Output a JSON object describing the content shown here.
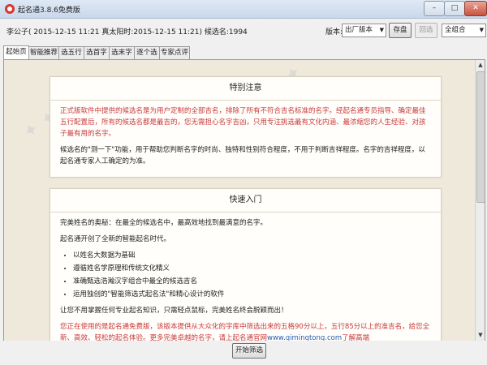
{
  "window": {
    "title": "起名通3.8.6免费版",
    "min_glyph": "–",
    "max_glyph": "□",
    "close_glyph": "✕"
  },
  "infobar": {
    "text": "李公子( 2015-12-15 11:21 真太阳时:2015-12-15 11:21) 候选名:1994",
    "version_label": "版本:",
    "version_value": "出厂版本",
    "save_label": "存盘",
    "pick_label": "回选",
    "combo_value": "全组合"
  },
  "tabs": [
    "起始页",
    "智能推荐",
    "选五行",
    "选首字",
    "选末字",
    "逐个选",
    "专家点评"
  ],
  "cards": {
    "notice": {
      "title": "特别注意",
      "p1": "正式版软件中提供的候选名是为用户定制的全部吉名，排除了所有不符合吉名标准的名字。经起名通专员指导、确定最佳五行配置后，所有的候选名都是最吉的，您无需担心名字吉凶，只用专注挑选最有文化内涵、最浓缩您的人生经验、对孩子最有用的名字。",
      "p2": "候选名的\"测一下\"功能，用于帮助您判断名字的时尚、独特和性别符合程度，不用于判断吉祥程度。名字的吉祥程度，以起名通专家人工确定的为准。"
    },
    "quickstart": {
      "title": "快速入门",
      "p1": "完美姓名的奥秘：在最全的候选名中，最高效地找到最满意的名字。",
      "p2": "起名通开创了全新的智能起名时代。",
      "features": [
        "以姓名大数据为基础",
        "遵循姓名学原理和传统文化精义",
        "准确甄选浩瀚汉字组合中最全的候选吉名",
        "运用独创的\"智能筛选式起名法\"和精心设计的软件"
      ],
      "p3": "让您不用掌握任何专业起名知识，只需轻点鼠标，完美姓名终会脱颖而出！",
      "p4a": "您正在使用的是起名通免费版，该版本提供从大众化的字库中筛选出来的五格90分以上，五行85分以上的准吉名，给您全新、高效、轻松的起名体验。更多完美卓越的名字，请上起名通官网",
      "site": "www.qimingtong.com",
      "p4b": "了解高端"
    }
  },
  "footer": {
    "start_label": "开始筛选"
  },
  "scroll": {
    "up": "▲",
    "down": "▼"
  },
  "colors": {
    "accent_red": "#c8393a",
    "link_blue": "#2a5db0",
    "content_bg": "#efe9dc"
  }
}
